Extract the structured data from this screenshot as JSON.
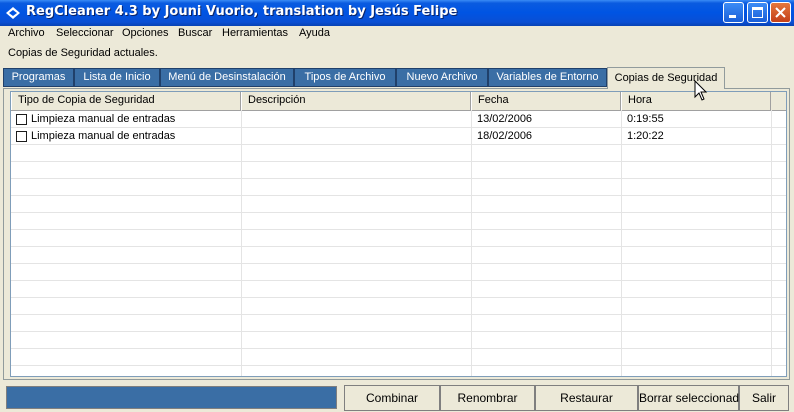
{
  "window": {
    "title": "RegCleaner 4.3 by Jouni Vuorio, translation by Jesús Felipe"
  },
  "menu": [
    "Archivo",
    "Seleccionar",
    "Opciones",
    "Buscar",
    "Herramientas",
    "Ayuda"
  ],
  "status_text": "Copias de Seguridad actuales.",
  "tabs": [
    "Programas",
    "Lista de Inicio",
    "Menú de Desinstalación",
    "Tipos de Archivo",
    "Nuevo Archivo",
    "Variables de Entorno",
    "Copias de Seguridad"
  ],
  "active_tab": "Copias de Seguridad",
  "table": {
    "columns": [
      "Tipo de Copia de Seguridad",
      "Descripción",
      "Fecha",
      "Hora"
    ],
    "rows": [
      {
        "type": "Limpieza manual de entradas",
        "description": "",
        "date": "13/02/2006",
        "time": "0:19:55",
        "checked": false
      },
      {
        "type": "Limpieza manual de entradas",
        "description": "",
        "date": "18/02/2006",
        "time": "1:20:22",
        "checked": false
      }
    ]
  },
  "buttons": [
    "Combinar",
    "Renombrar",
    "Restaurar",
    "Borrar seleccionado",
    "Salir"
  ],
  "colors": {
    "titlebar": "#0054e3",
    "tab_inactive": "#3a6ea5",
    "progress": "#3a6ea5"
  }
}
